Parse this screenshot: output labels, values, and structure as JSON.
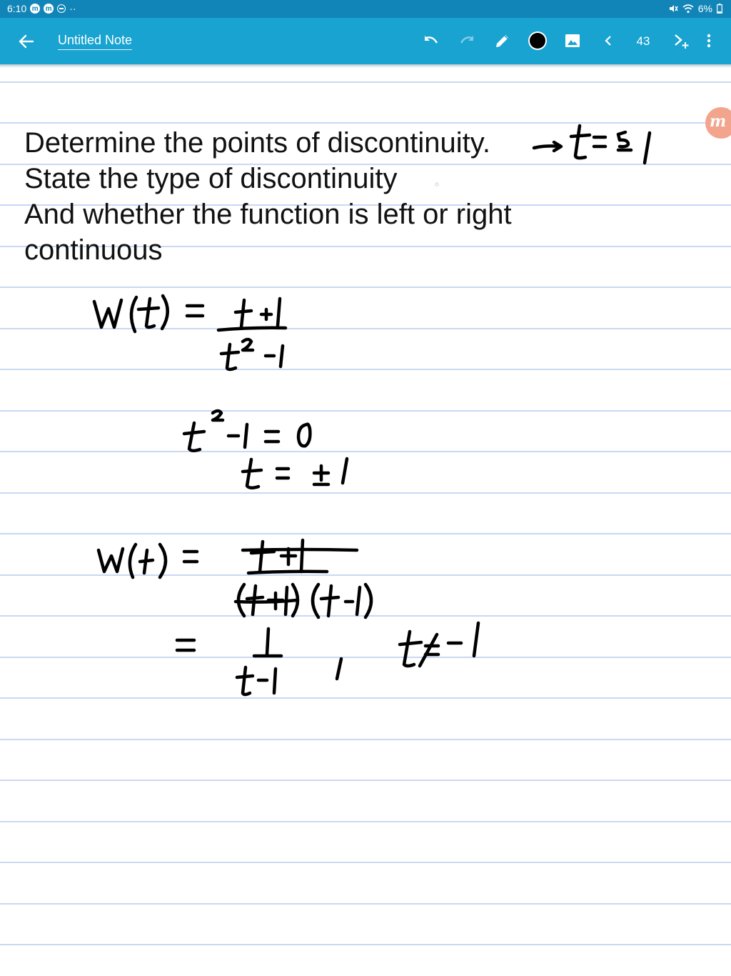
{
  "status_bar": {
    "time": "6:10",
    "battery": "6%",
    "icons": [
      "meet-icon",
      "meet-icon",
      "do-not-disturb-icon",
      "dots-icon",
      "mute-icon",
      "wifi-icon",
      "battery-icon"
    ]
  },
  "app_bar": {
    "note_title": "Untitled Note",
    "page_number": "43",
    "pen_color": "#000000",
    "icons": [
      "back-arrow-icon",
      "undo-icon",
      "redo-icon",
      "pen-icon",
      "color-dot-icon",
      "image-icon",
      "chevron-left-icon",
      "add-page-icon",
      "more-vert-icon"
    ]
  },
  "note": {
    "prompt_lines": [
      "Determine the points of discontinuity.",
      "State the type of discontinuity",
      "And whether the function is left or right",
      "continuous"
    ]
  },
  "floating_badge": {
    "letter": "m"
  },
  "colors": {
    "status_bar": "#1185b8",
    "app_bar": "#19a3d1",
    "ruled_line": "#c9d8f4",
    "ink": "#000000",
    "badge": "#f3a48c"
  }
}
